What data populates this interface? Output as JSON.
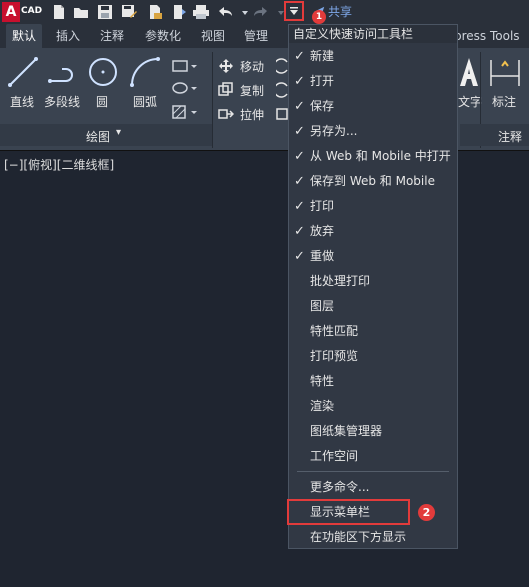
{
  "app": {
    "logo_letter": "A",
    "logo_text": "CAD"
  },
  "qat": {
    "share_label": "共享",
    "badge": "1"
  },
  "tabs": [
    {
      "label": "默认"
    },
    {
      "label": "插入"
    },
    {
      "label": "注释"
    },
    {
      "label": "参数化"
    },
    {
      "label": "视图"
    },
    {
      "label": "管理"
    },
    {
      "label": "press Tools"
    }
  ],
  "ribbon": {
    "draw": {
      "line": "直线",
      "polyline": "多段线",
      "circle": "圆",
      "arc": "圆弧",
      "group_label": "绘图"
    },
    "modify": {
      "move": "移动",
      "copy": "复制",
      "stretch": "拉伸"
    },
    "annotation": {
      "text": "文字",
      "dimension": "标注",
      "group_label": "注释"
    }
  },
  "viewport": {
    "label": "[−][俯视][二维线框]"
  },
  "menu": {
    "title": "自定义快速访问工具栏",
    "items": [
      {
        "label": "新建",
        "checked": "✓"
      },
      {
        "label": "打开",
        "checked": "✓"
      },
      {
        "label": "保存",
        "checked": "✓"
      },
      {
        "label": "另存为...",
        "checked": "✓"
      },
      {
        "label": "从 Web 和 Mobile 中打开",
        "checked": "✓"
      },
      {
        "label": "保存到 Web 和 Mobile",
        "checked": "✓"
      },
      {
        "label": "打印",
        "checked": "✓"
      },
      {
        "label": "放弃",
        "checked": "✓"
      },
      {
        "label": "重做",
        "checked": "✓"
      },
      {
        "label": "批处理打印",
        "checked": ""
      },
      {
        "label": "图层",
        "checked": ""
      },
      {
        "label": "特性匹配",
        "checked": ""
      },
      {
        "label": "打印预览",
        "checked": ""
      },
      {
        "label": "特性",
        "checked": ""
      },
      {
        "label": "渲染",
        "checked": ""
      },
      {
        "label": "图纸集管理器",
        "checked": ""
      },
      {
        "label": "工作空间",
        "checked": ""
      },
      {
        "label": "更多命令...",
        "checked": ""
      },
      {
        "label": "显示菜单栏",
        "checked": ""
      },
      {
        "label": "在功能区下方显示",
        "checked": ""
      }
    ],
    "badge": "2"
  }
}
